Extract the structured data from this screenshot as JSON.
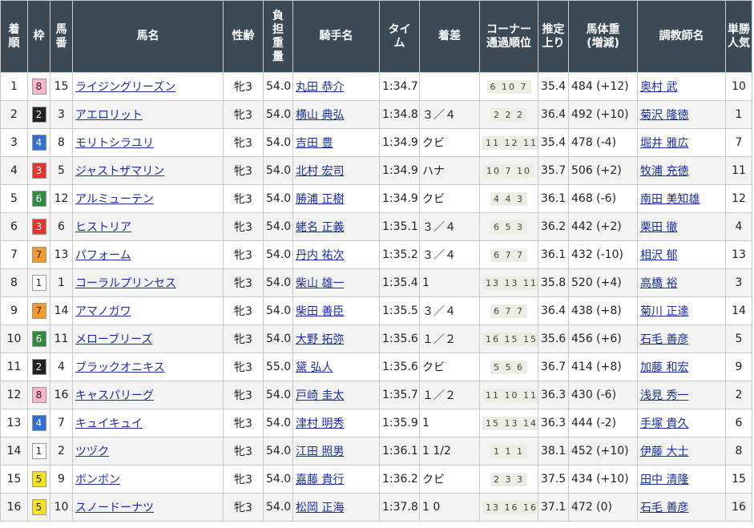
{
  "headers": {
    "finish": "着順",
    "frame": "枠",
    "number": "馬番",
    "horse": "馬名",
    "sexage": "性齢",
    "weight": "負担重量",
    "jockey": "騎手名",
    "time": "タイム",
    "margin": "着差",
    "corner": "コーナー通過順位",
    "last3f": "推定上り",
    "bodyweight": "馬体重(増減)",
    "trainer": "調教師名",
    "popularity": "単勝人気"
  },
  "frame_colors": {
    "1": {
      "bg": "#ffffff",
      "fg": "#222222"
    },
    "2": {
      "bg": "#222222",
      "fg": "#ffffff"
    },
    "3": {
      "bg": "#e8322e",
      "fg": "#ffffff"
    },
    "4": {
      "bg": "#2f6fd6",
      "fg": "#ffffff"
    },
    "5": {
      "bg": "#f6e21d",
      "fg": "#222222"
    },
    "6": {
      "bg": "#2e8b3f",
      "fg": "#ffffff"
    },
    "7": {
      "bg": "#f59a2a",
      "fg": "#222222"
    },
    "8": {
      "bg": "#f9b6c8",
      "fg": "#222222"
    }
  },
  "rows": [
    {
      "finish": "1",
      "frame": "8",
      "number": "15",
      "horse": "ライジングリーズン",
      "sexage": "牝3",
      "weight": "54.0",
      "jockey": "丸田 恭介",
      "time": "1:34.7",
      "margin": "",
      "corner": "6 10 7",
      "last3f": "35.4",
      "bodyweight": "484 (+12)",
      "trainer": "奥村 武",
      "popularity": "10"
    },
    {
      "finish": "2",
      "frame": "2",
      "number": "3",
      "horse": "アエロリット",
      "sexage": "牝3",
      "weight": "54.0",
      "jockey": "横山 典弘",
      "time": "1:34.8",
      "margin": "３／４",
      "corner": "2 2 2",
      "last3f": "36.4",
      "bodyweight": "492 (+10)",
      "trainer": "菊沢 隆徳",
      "popularity": "1"
    },
    {
      "finish": "3",
      "frame": "4",
      "number": "8",
      "horse": "モリトシラユリ",
      "sexage": "牝3",
      "weight": "54.0",
      "jockey": "吉田 豊",
      "time": "1:34.9",
      "margin": "クビ",
      "corner": "11 12 11",
      "last3f": "35.4",
      "bodyweight": "478 (-4)",
      "trainer": "堀井 雅広",
      "popularity": "7"
    },
    {
      "finish": "4",
      "frame": "3",
      "number": "5",
      "horse": "ジャストザマリン",
      "sexage": "牝3",
      "weight": "54.0",
      "jockey": "北村 宏司",
      "time": "1:34.9",
      "margin": "ハナ",
      "corner": "10 7 10",
      "last3f": "35.7",
      "bodyweight": "506 (+2)",
      "trainer": "牧浦 充徳",
      "popularity": "11"
    },
    {
      "finish": "5",
      "frame": "6",
      "number": "12",
      "horse": "アルミューテン",
      "sexage": "牝3",
      "weight": "54.0",
      "jockey": "勝浦 正樹",
      "time": "1:34.9",
      "margin": "クビ",
      "corner": "4 4 3",
      "last3f": "36.1",
      "bodyweight": "468 (-6)",
      "trainer": "南田 美知雄",
      "popularity": "12"
    },
    {
      "finish": "6",
      "frame": "3",
      "number": "6",
      "horse": "ヒストリア",
      "sexage": "牝3",
      "weight": "54.0",
      "jockey": "蛯名 正義",
      "time": "1:35.1",
      "margin": "３／４",
      "corner": "6 5 3",
      "last3f": "36.2",
      "bodyweight": "442 (+2)",
      "trainer": "栗田 徹",
      "popularity": "4"
    },
    {
      "finish": "7",
      "frame": "7",
      "number": "13",
      "horse": "パフォーム",
      "sexage": "牝3",
      "weight": "54.0",
      "jockey": "丹内 祐次",
      "time": "1:35.2",
      "margin": "３／４",
      "corner": "6 7 7",
      "last3f": "36.1",
      "bodyweight": "432 (-10)",
      "trainer": "相沢 郁",
      "popularity": "13"
    },
    {
      "finish": "8",
      "frame": "1",
      "number": "1",
      "horse": "コーラルプリンセス",
      "sexage": "牝3",
      "weight": "54.0",
      "jockey": "柴山 雄一",
      "time": "1:35.4",
      "margin": "1",
      "corner": "13 13 11",
      "last3f": "35.8",
      "bodyweight": "520 (+4)",
      "trainer": "高橋 裕",
      "popularity": "3"
    },
    {
      "finish": "9",
      "frame": "7",
      "number": "14",
      "horse": "アマノガワ",
      "sexage": "牝3",
      "weight": "54.0",
      "jockey": "柴田 善臣",
      "time": "1:35.5",
      "margin": "３／４",
      "corner": "6 7 7",
      "last3f": "36.4",
      "bodyweight": "438 (+8)",
      "trainer": "菊川 正達",
      "popularity": "14"
    },
    {
      "finish": "10",
      "frame": "6",
      "number": "11",
      "horse": "メローブリーズ",
      "sexage": "牝3",
      "weight": "54.0",
      "jockey": "大野 拓弥",
      "time": "1:35.6",
      "margin": "１／２",
      "corner": "16 15 15",
      "last3f": "35.6",
      "bodyweight": "456 (+6)",
      "trainer": "石毛 善彦",
      "popularity": "5"
    },
    {
      "finish": "11",
      "frame": "2",
      "number": "4",
      "horse": "ブラックオニキス",
      "sexage": "牝3",
      "weight": "55.0",
      "jockey": "黛 弘人",
      "time": "1:35.6",
      "margin": "クビ",
      "corner": "5 5 6",
      "last3f": "36.7",
      "bodyweight": "414 (+8)",
      "trainer": "加藤 和宏",
      "popularity": "9"
    },
    {
      "finish": "12",
      "frame": "8",
      "number": "16",
      "horse": "キャスパリーグ",
      "sexage": "牝3",
      "weight": "54.0",
      "jockey": "戸崎 圭太",
      "time": "1:35.7",
      "margin": "１／２",
      "corner": "11 10 11",
      "last3f": "36.3",
      "bodyweight": "430 (-6)",
      "trainer": "浅見 秀一",
      "popularity": "2"
    },
    {
      "finish": "13",
      "frame": "4",
      "number": "7",
      "horse": "キュイキュイ",
      "sexage": "牝3",
      "weight": "54.0",
      "jockey": "津村 明秀",
      "time": "1:35.9",
      "margin": "1",
      "corner": "15 13 14",
      "last3f": "36.3",
      "bodyweight": "444 (-2)",
      "trainer": "手塚 貴久",
      "popularity": "6"
    },
    {
      "finish": "14",
      "frame": "1",
      "number": "2",
      "horse": "ツヅク",
      "sexage": "牝3",
      "weight": "54.0",
      "jockey": "江田 照男",
      "time": "1:36.1",
      "margin": "1 1/2",
      "corner": "1 1 1",
      "last3f": "38.1",
      "bodyweight": "452 (+10)",
      "trainer": "伊藤 大士",
      "popularity": "8"
    },
    {
      "finish": "15",
      "frame": "5",
      "number": "9",
      "horse": "ボンボン",
      "sexage": "牝3",
      "weight": "54.0",
      "jockey": "嘉藤 貴行",
      "time": "1:36.2",
      "margin": "クビ",
      "corner": "2 3 3",
      "last3f": "37.5",
      "bodyweight": "434 (+10)",
      "trainer": "田中 清隆",
      "popularity": "15"
    },
    {
      "finish": "16",
      "frame": "5",
      "number": "10",
      "horse": "スノードーナツ",
      "sexage": "牝3",
      "weight": "54.0",
      "jockey": "松岡 正海",
      "time": "1:37.8",
      "margin": "1 0",
      "corner": "13 16 16",
      "last3f": "37.1",
      "bodyweight": "472 (0)",
      "trainer": "石毛 善彦",
      "popularity": "16"
    }
  ]
}
